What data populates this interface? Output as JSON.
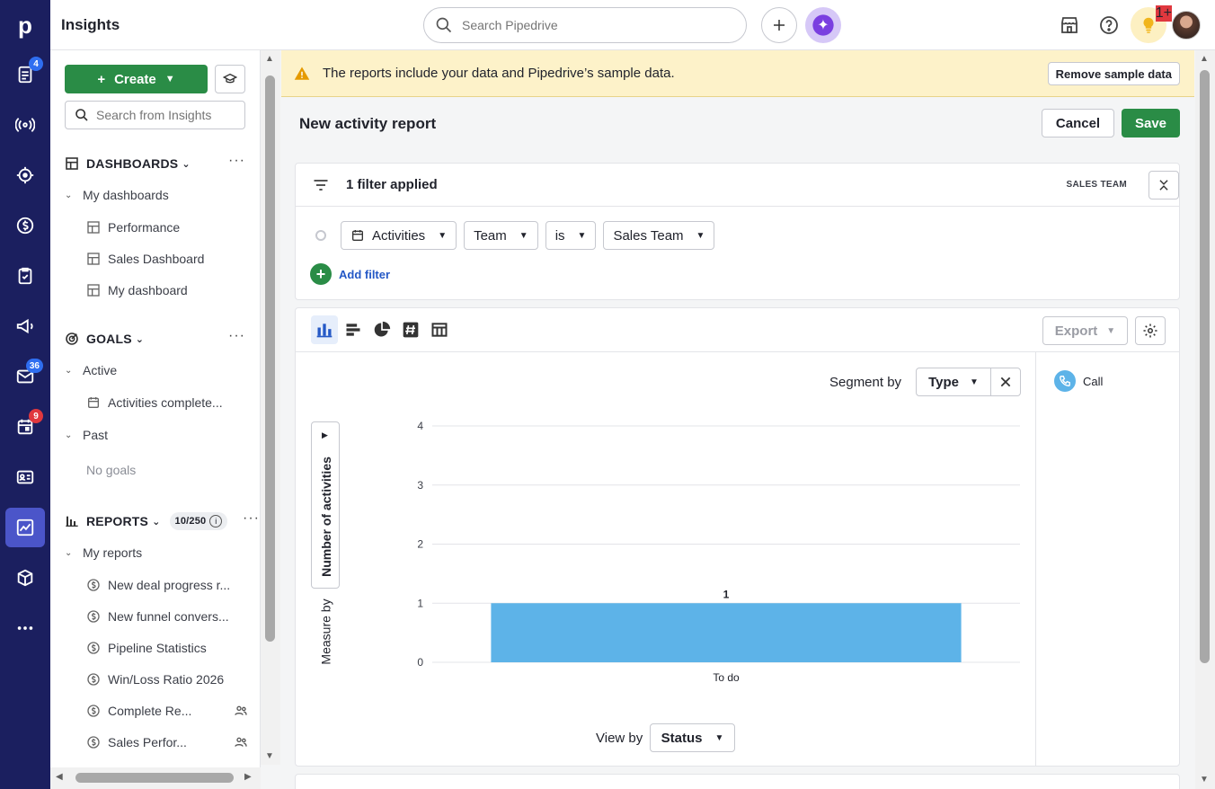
{
  "rail": {
    "logo": "p",
    "badges": {
      "leads": "4",
      "mail": "36",
      "calendar": "9"
    }
  },
  "topbar": {
    "title": "Insights",
    "search_placeholder": "Search Pipedrive",
    "notif_badge": "1+"
  },
  "sidebar": {
    "create_label": "Create",
    "search_placeholder": "Search from Insights",
    "dashboards": {
      "heading": "DASHBOARDS",
      "group": "My dashboards",
      "items": [
        "Performance",
        "Sales Dashboard",
        "My dashboard"
      ]
    },
    "goals": {
      "heading": "GOALS",
      "active_group": "Active",
      "active_items": [
        "Activities complete..."
      ],
      "past_group": "Past",
      "past_empty": "No goals"
    },
    "reports": {
      "heading": "REPORTS",
      "count": "10/250",
      "group": "My reports",
      "items": [
        "New deal progress r...",
        "New funnel convers...",
        "Pipeline Statistics",
        "Win/Loss Ratio 2026",
        "Complete Re...",
        "Sales Perfor..."
      ]
    }
  },
  "banner": {
    "message": "The reports include your data and Pipedrive’s sample data.",
    "button": "Remove sample data"
  },
  "report": {
    "title": "New activity report",
    "cancel": "Cancel",
    "save": "Save"
  },
  "filters": {
    "summary": "1 filter applied",
    "tag": "SALES TEAM",
    "row": {
      "entity": "Activities",
      "field": "Team",
      "operator": "is",
      "value": "Sales Team"
    },
    "add_label": "Add filter"
  },
  "chart_toolbar": {
    "export": "Export"
  },
  "chart_controls": {
    "segment_label": "Segment by",
    "segment_value": "Type",
    "measure_value": "Number of activities",
    "measure_label": "Measure by",
    "viewby_label": "View by",
    "viewby_value": "Status"
  },
  "legend": [
    {
      "name": "Call",
      "color": "#5db3e8"
    }
  ],
  "chart_data": {
    "type": "bar",
    "categories": [
      "To do"
    ],
    "series": [
      {
        "name": "Call",
        "values": [
          1
        ]
      }
    ],
    "data_labels": [
      "1"
    ],
    "ylabel": "Number of activities",
    "xlabel": "Status",
    "ylim": [
      0,
      4
    ],
    "yticks": [
      0,
      1,
      2,
      3,
      4
    ],
    "grid": true,
    "bar_color": "#5db3e8"
  }
}
